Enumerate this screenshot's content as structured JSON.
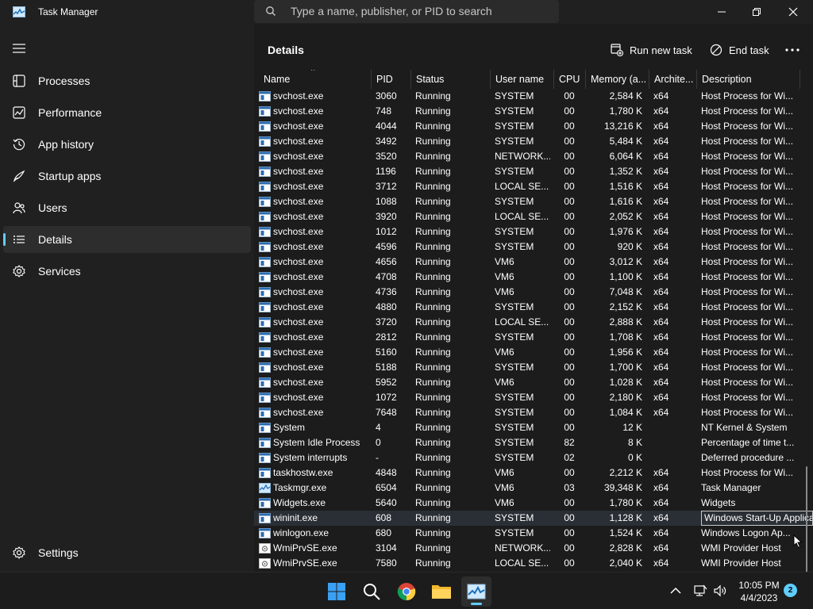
{
  "window": {
    "title": "Task Manager"
  },
  "search": {
    "placeholder": "Type a name, publisher, or PID to search"
  },
  "sidebar": {
    "items": [
      {
        "label": "Processes",
        "icon": "processes-icon"
      },
      {
        "label": "Performance",
        "icon": "performance-icon"
      },
      {
        "label": "App history",
        "icon": "app-history-icon"
      },
      {
        "label": "Startup apps",
        "icon": "startup-apps-icon"
      },
      {
        "label": "Users",
        "icon": "users-icon"
      },
      {
        "label": "Details",
        "icon": "details-icon",
        "active": true
      },
      {
        "label": "Services",
        "icon": "services-icon"
      }
    ],
    "settings_label": "Settings"
  },
  "toolbar": {
    "title": "Details",
    "run_new_task": "Run new task",
    "end_task": "End task"
  },
  "table": {
    "columns": [
      "Name",
      "PID",
      "Status",
      "User name",
      "CPU",
      "Memory (a...",
      "Archite...",
      "Description"
    ],
    "rows": [
      {
        "name": "svchost.exe",
        "pid": "3060",
        "status": "Running",
        "user": "SYSTEM",
        "cpu": "00",
        "mem": "2,584 K",
        "arch": "x64",
        "desc": "Host Process for Wi..."
      },
      {
        "name": "svchost.exe",
        "pid": "748",
        "status": "Running",
        "user": "SYSTEM",
        "cpu": "00",
        "mem": "1,780 K",
        "arch": "x64",
        "desc": "Host Process for Wi..."
      },
      {
        "name": "svchost.exe",
        "pid": "4044",
        "status": "Running",
        "user": "SYSTEM",
        "cpu": "00",
        "mem": "13,216 K",
        "arch": "x64",
        "desc": "Host Process for Wi..."
      },
      {
        "name": "svchost.exe",
        "pid": "3492",
        "status": "Running",
        "user": "SYSTEM",
        "cpu": "00",
        "mem": "5,484 K",
        "arch": "x64",
        "desc": "Host Process for Wi..."
      },
      {
        "name": "svchost.exe",
        "pid": "3520",
        "status": "Running",
        "user": "NETWORK...",
        "cpu": "00",
        "mem": "6,064 K",
        "arch": "x64",
        "desc": "Host Process for Wi..."
      },
      {
        "name": "svchost.exe",
        "pid": "1196",
        "status": "Running",
        "user": "SYSTEM",
        "cpu": "00",
        "mem": "1,352 K",
        "arch": "x64",
        "desc": "Host Process for Wi..."
      },
      {
        "name": "svchost.exe",
        "pid": "3712",
        "status": "Running",
        "user": "LOCAL SE...",
        "cpu": "00",
        "mem": "1,516 K",
        "arch": "x64",
        "desc": "Host Process for Wi..."
      },
      {
        "name": "svchost.exe",
        "pid": "1088",
        "status": "Running",
        "user": "SYSTEM",
        "cpu": "00",
        "mem": "1,616 K",
        "arch": "x64",
        "desc": "Host Process for Wi..."
      },
      {
        "name": "svchost.exe",
        "pid": "3920",
        "status": "Running",
        "user": "LOCAL SE...",
        "cpu": "00",
        "mem": "2,052 K",
        "arch": "x64",
        "desc": "Host Process for Wi..."
      },
      {
        "name": "svchost.exe",
        "pid": "1012",
        "status": "Running",
        "user": "SYSTEM",
        "cpu": "00",
        "mem": "1,976 K",
        "arch": "x64",
        "desc": "Host Process for Wi..."
      },
      {
        "name": "svchost.exe",
        "pid": "4596",
        "status": "Running",
        "user": "SYSTEM",
        "cpu": "00",
        "mem": "920 K",
        "arch": "x64",
        "desc": "Host Process for Wi..."
      },
      {
        "name": "svchost.exe",
        "pid": "4656",
        "status": "Running",
        "user": "VM6",
        "cpu": "00",
        "mem": "3,012 K",
        "arch": "x64",
        "desc": "Host Process for Wi..."
      },
      {
        "name": "svchost.exe",
        "pid": "4708",
        "status": "Running",
        "user": "VM6",
        "cpu": "00",
        "mem": "1,100 K",
        "arch": "x64",
        "desc": "Host Process for Wi..."
      },
      {
        "name": "svchost.exe",
        "pid": "4736",
        "status": "Running",
        "user": "VM6",
        "cpu": "00",
        "mem": "7,048 K",
        "arch": "x64",
        "desc": "Host Process for Wi..."
      },
      {
        "name": "svchost.exe",
        "pid": "4880",
        "status": "Running",
        "user": "SYSTEM",
        "cpu": "00",
        "mem": "2,152 K",
        "arch": "x64",
        "desc": "Host Process for Wi..."
      },
      {
        "name": "svchost.exe",
        "pid": "3720",
        "status": "Running",
        "user": "LOCAL SE...",
        "cpu": "00",
        "mem": "2,888 K",
        "arch": "x64",
        "desc": "Host Process for Wi..."
      },
      {
        "name": "svchost.exe",
        "pid": "2812",
        "status": "Running",
        "user": "SYSTEM",
        "cpu": "00",
        "mem": "1,708 K",
        "arch": "x64",
        "desc": "Host Process for Wi..."
      },
      {
        "name": "svchost.exe",
        "pid": "5160",
        "status": "Running",
        "user": "VM6",
        "cpu": "00",
        "mem": "1,956 K",
        "arch": "x64",
        "desc": "Host Process for Wi..."
      },
      {
        "name": "svchost.exe",
        "pid": "5188",
        "status": "Running",
        "user": "SYSTEM",
        "cpu": "00",
        "mem": "1,700 K",
        "arch": "x64",
        "desc": "Host Process for Wi..."
      },
      {
        "name": "svchost.exe",
        "pid": "5952",
        "status": "Running",
        "user": "VM6",
        "cpu": "00",
        "mem": "1,028 K",
        "arch": "x64",
        "desc": "Host Process for Wi..."
      },
      {
        "name": "svchost.exe",
        "pid": "1072",
        "status": "Running",
        "user": "SYSTEM",
        "cpu": "00",
        "mem": "2,180 K",
        "arch": "x64",
        "desc": "Host Process for Wi..."
      },
      {
        "name": "svchost.exe",
        "pid": "7648",
        "status": "Running",
        "user": "SYSTEM",
        "cpu": "00",
        "mem": "1,084 K",
        "arch": "x64",
        "desc": "Host Process for Wi..."
      },
      {
        "name": "System",
        "pid": "4",
        "status": "Running",
        "user": "SYSTEM",
        "cpu": "00",
        "mem": "12 K",
        "arch": "",
        "desc": "NT Kernel & System"
      },
      {
        "name": "System Idle Process",
        "pid": "0",
        "status": "Running",
        "user": "SYSTEM",
        "cpu": "82",
        "mem": "8 K",
        "arch": "",
        "desc": "Percentage of time t..."
      },
      {
        "name": "System interrupts",
        "pid": "-",
        "status": "Running",
        "user": "SYSTEM",
        "cpu": "02",
        "mem": "0 K",
        "arch": "",
        "desc": "Deferred procedure ..."
      },
      {
        "name": "taskhostw.exe",
        "pid": "4848",
        "status": "Running",
        "user": "VM6",
        "cpu": "00",
        "mem": "2,212 K",
        "arch": "x64",
        "desc": "Host Process for Wi..."
      },
      {
        "name": "Taskmgr.exe",
        "pid": "6504",
        "status": "Running",
        "user": "VM6",
        "cpu": "03",
        "mem": "39,348 K",
        "arch": "x64",
        "desc": "Task Manager",
        "icon": "taskmgr"
      },
      {
        "name": "Widgets.exe",
        "pid": "5640",
        "status": "Running",
        "user": "VM6",
        "cpu": "00",
        "mem": "1,780 K",
        "arch": "x64",
        "desc": "Widgets"
      },
      {
        "name": "wininit.exe",
        "pid": "608",
        "status": "Running",
        "user": "SYSTEM",
        "cpu": "00",
        "mem": "1,128 K",
        "arch": "x64",
        "desc": "Windows Start-Up Applicat",
        "selected": true
      },
      {
        "name": "winlogon.exe",
        "pid": "680",
        "status": "Running",
        "user": "SYSTEM",
        "cpu": "00",
        "mem": "1,524 K",
        "arch": "x64",
        "desc": "Windows Logon Ap..."
      },
      {
        "name": "WmiPrvSE.exe",
        "pid": "3104",
        "status": "Running",
        "user": "NETWORK...",
        "cpu": "00",
        "mem": "2,828 K",
        "arch": "x64",
        "desc": "WMI Provider Host",
        "icon": "wmi"
      },
      {
        "name": "WmiPrvSE.exe",
        "pid": "7580",
        "status": "Running",
        "user": "LOCAL SE...",
        "cpu": "00",
        "mem": "2,040 K",
        "arch": "x64",
        "desc": "WMI Provider Host",
        "icon": "wmi"
      }
    ]
  },
  "taskbar": {
    "apps": [
      "start-icon",
      "search-icon",
      "chrome-icon",
      "file-explorer-icon",
      "task-manager-icon"
    ],
    "time": "10:05 PM",
    "date": "4/4/2023",
    "notification_count": "2"
  },
  "colors": {
    "accent": "#60cdff",
    "background": "#202020",
    "selection": "#2a2f35"
  }
}
